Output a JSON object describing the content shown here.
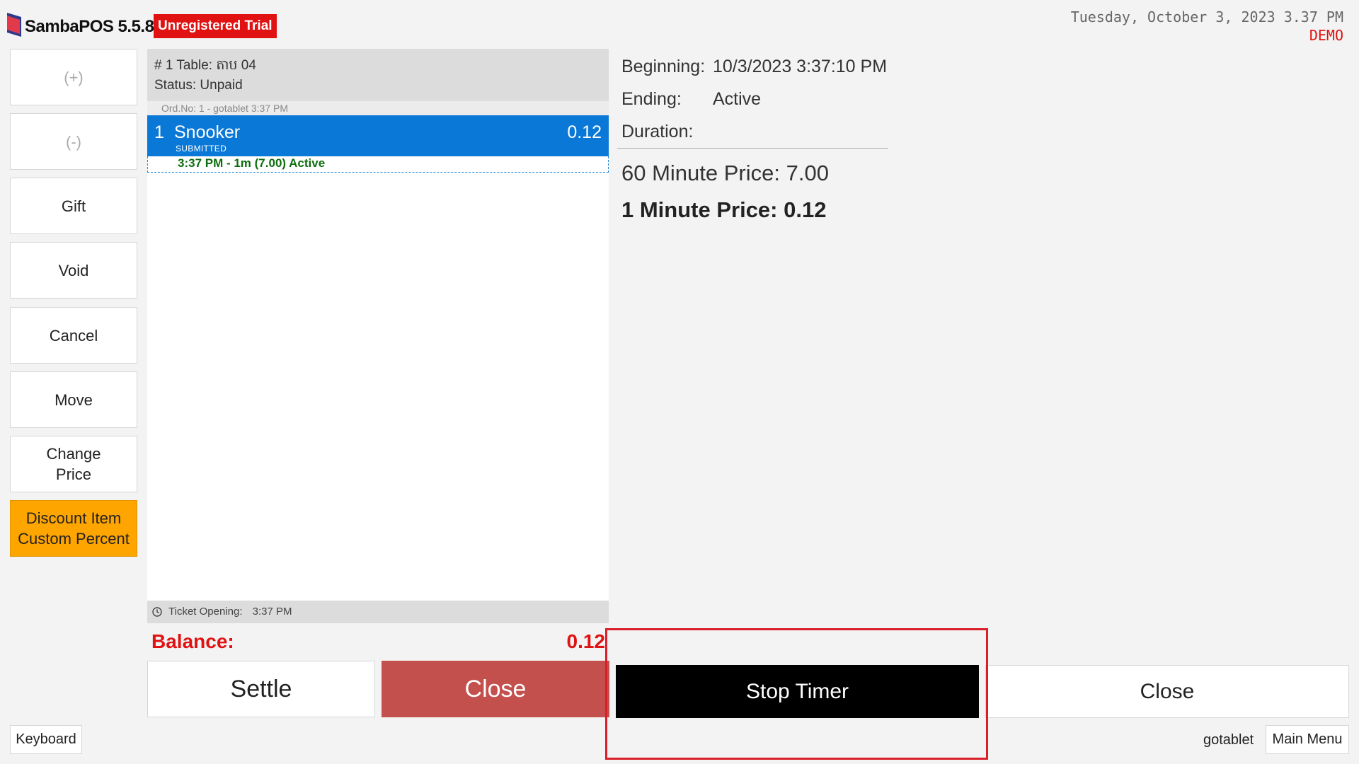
{
  "header": {
    "app_title": "SambaPOS 5.5.8",
    "trial_badge": "Unregistered Trial",
    "datetime": "Tuesday, October 3, 2023 3.37 PM",
    "mode": "DEMO"
  },
  "sidebar": {
    "buttons": [
      {
        "label": "(+)",
        "enabled": false
      },
      {
        "label": "(-)",
        "enabled": false
      },
      {
        "label": "Gift",
        "enabled": true
      },
      {
        "label": "Void",
        "enabled": true
      },
      {
        "label": "Cancel",
        "enabled": true
      },
      {
        "label": "Move",
        "enabled": true
      },
      {
        "label": "Change\nPrice",
        "enabled": true
      },
      {
        "label": "Discount Item\nCustom Percent",
        "enabled": true
      }
    ]
  },
  "ticket": {
    "header_line1": "# 1 Table: តាប 04",
    "header_line2": "Status: Unpaid",
    "order_info": "Ord.No: 1 - gotablet  3:37 PM",
    "order": {
      "qty": "1",
      "name": "Snooker",
      "state": "SUBMITTED",
      "price": "0.12",
      "timer": "3:37 PM - 1m (7.00) Active"
    },
    "footer_label": "Ticket Opening:",
    "footer_time": "3:37 PM"
  },
  "balance": {
    "label": "Balance:",
    "value": "0.12"
  },
  "ticket_buttons": {
    "settle": "Settle",
    "close": "Close"
  },
  "details": {
    "beginning_label": "Beginning:",
    "beginning_value": "10/3/2023 3:37:10 PM",
    "ending_label": "Ending:",
    "ending_value": "Active",
    "duration_label": "Duration:",
    "price_60": "60 Minute Price: 7.00",
    "price_1": "1 Minute Price: 0.12"
  },
  "actions": {
    "stop_timer": "Stop Timer",
    "close": "Close"
  },
  "footer": {
    "keyboard": "Keyboard",
    "user": "gotablet",
    "main_menu": "Main Menu"
  },
  "colors": {
    "selected_order": "#0a78d7",
    "trial_badge": "#e01212",
    "balance": "#e01212",
    "discount_button": "#ffa500",
    "close_ticket_button": "#c4504e",
    "stop_timer_button": "#000000",
    "highlight_border": "#d81f2a"
  }
}
